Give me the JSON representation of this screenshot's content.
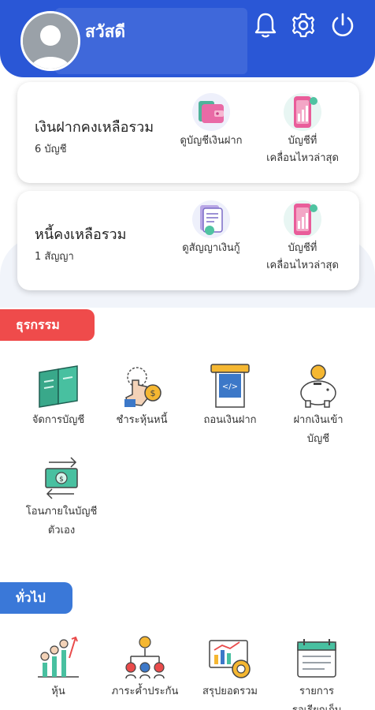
{
  "header": {
    "greeting": "สวัสดี",
    "bg_color": "#2a57d6",
    "icons": [
      "bell-icon",
      "gear-icon",
      "power-icon"
    ]
  },
  "deposit_card": {
    "title": "เงินฝากคงเหลือรวม",
    "subtitle": "6 บัญชี",
    "actions": [
      {
        "icon": "wallet-icon",
        "label": "ดูบัญชีเงินฝาก"
      },
      {
        "icon": "phone-chart-icon",
        "label_line1": "บัญชีที่",
        "label_line2": "เคลื่อนไหวล่าสุด"
      }
    ]
  },
  "loan_card": {
    "title": "หนี้คงเหลือรวม",
    "subtitle": "1 สัญญา",
    "actions": [
      {
        "icon": "contract-icon",
        "label": "ดูสัญญาเงินกู้"
      },
      {
        "icon": "phone-chart-icon",
        "label_line1": "บัญชีที่",
        "label_line2": "เคลื่อนไหวล่าสุด"
      }
    ]
  },
  "transactions": {
    "title": "ธุรกรรม",
    "color": "#ef4b4b",
    "items": [
      {
        "icon": "passbook-icon",
        "label_line1": "จัดการบัญชี",
        "label_line2": ""
      },
      {
        "icon": "hand-coin-icon",
        "label_line1": "ชำระหุ้นหนี้",
        "label_line2": ""
      },
      {
        "icon": "atm-withdraw-icon",
        "label_line1": "ถอนเงินฝาก",
        "label_line2": ""
      },
      {
        "icon": "piggy-bank-icon",
        "label_line1": "ฝากเงินเข้า",
        "label_line2": "บัญชี"
      },
      {
        "icon": "money-transfer-icon",
        "label_line1": "โอนภายในบัญชี",
        "label_line2": "ตัวเอง"
      }
    ]
  },
  "general": {
    "title": "ทั่วไป",
    "color": "#3a78d8",
    "items": [
      {
        "icon": "stock-people-icon",
        "label_line1": "หุ้น"
      },
      {
        "icon": "guarantor-network-icon",
        "label_line1": "ภาระค้ำประกัน"
      },
      {
        "icon": "summary-chart-icon",
        "label_line1": "สรุปยอดรวม"
      },
      {
        "icon": "calendar-list-icon",
        "label_line1": "รายการ",
        "label_line2": "รอเรียกเก็บ"
      }
    ]
  }
}
